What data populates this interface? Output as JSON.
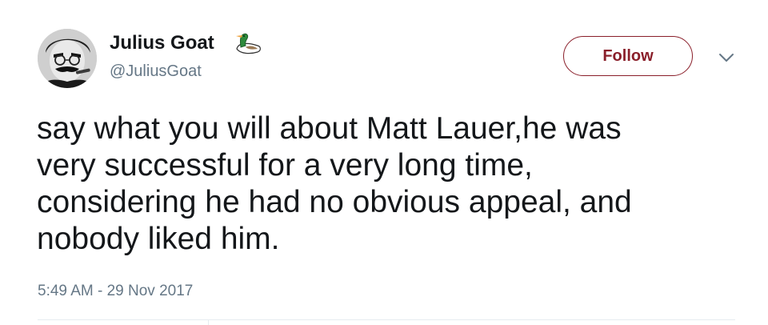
{
  "author": {
    "display_name": "Julius Goat",
    "handle": "@JuliusGoat",
    "avatar_icon": "portrait-photo",
    "badge_icon": "duck-emoji-icon"
  },
  "actions": {
    "follow_label": "Follow",
    "menu_icon": "chevron-down-icon"
  },
  "tweet": {
    "text": "say what you will about Matt Lauer,he was\nvery successful for a very long time,\nconsidering he had no obvious appeal, and\nnobody liked him.",
    "timestamp": "5:49 AM - 29 Nov 2017"
  },
  "colors": {
    "text": "#14171a",
    "secondary_text": "#657786",
    "follow_accent": "#8a1f2a",
    "divider": "#e6ecf0"
  }
}
